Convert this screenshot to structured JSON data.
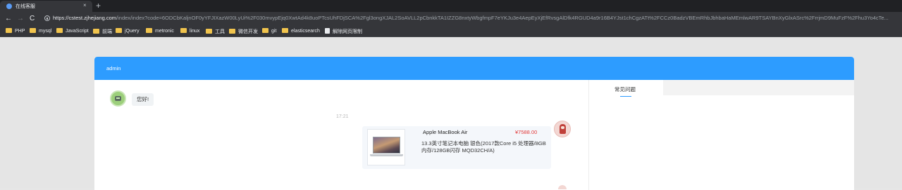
{
  "browser": {
    "tab_title": "在线客服",
    "tab_close": "×",
    "new_tab": "+",
    "nav": {
      "back": "←",
      "forward": "→",
      "reload": "C"
    },
    "url_host": "https://cstest.zjhejiang.com",
    "url_path": "/index/index?code=6ODCbKaljnOF0yYFJIXazW00LyUi%2F030mvypEjq0XwtAd4k8uoPTcsUhFDjSCA%2Fgl3ongXJAL2SoAVLL2pCbnkkTA1IZZG8nxtyWbgfmpF7eYKJu3e4AepEyXjEfRvsgAlDfk4RGUD4a9r16B4YJst1chCgzATt%2FCCz0BadzVBEmRhbJbhbaHaMEmlwAR9TSAYBnXyGlxASrc%2FrrjmD9MuFzF%2Fhu3Yo4cTe..."
  },
  "bookmarks": [
    {
      "label": "PHP",
      "type": "folder"
    },
    {
      "label": "mysql",
      "type": "folder"
    },
    {
      "label": "JavaScript",
      "type": "folder"
    },
    {
      "label": "前端",
      "type": "folder"
    },
    {
      "label": "jQuery",
      "type": "folder"
    },
    {
      "label": "metronic",
      "type": "folder"
    },
    {
      "label": "linux",
      "type": "folder"
    },
    {
      "label": "工具",
      "type": "folder"
    },
    {
      "label": "微信开发",
      "type": "folder"
    },
    {
      "label": "git",
      "type": "folder"
    },
    {
      "label": "elasticsearch",
      "type": "folder"
    },
    {
      "label": "解除网页限制",
      "type": "page"
    }
  ],
  "chat": {
    "header_title": "admin",
    "greeting": "您好!",
    "timestamp": "17:21",
    "product": {
      "name": "Apple MacBook Air",
      "price": "¥7588.00",
      "description": "13.3英寸笔记本电脑 银色(2017款Core i5 处理器/8GB内存/128GB闪存 MQD32CH/A)"
    }
  },
  "side_panel": {
    "active_tab": "常见问题"
  },
  "colors": {
    "header_blue": "#2d9cff",
    "price_red": "#e23b3b"
  }
}
